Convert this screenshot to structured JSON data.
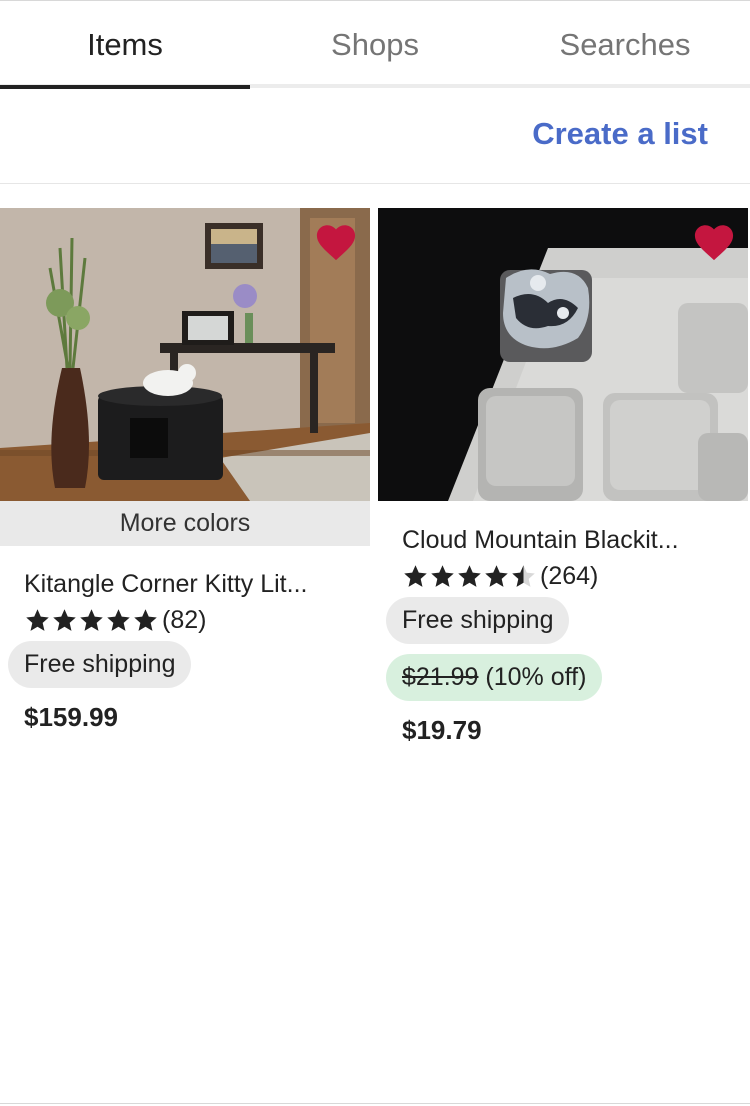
{
  "tabs": [
    {
      "label": "Items",
      "active": true
    },
    {
      "label": "Shops",
      "active": false
    },
    {
      "label": "Searches",
      "active": false
    }
  ],
  "list_bar": {
    "create_list_label": "Create a list"
  },
  "colors": {
    "accent": "#4a6bc8",
    "favorite": "#c4163f",
    "sale_bg": "#d8f0de",
    "pill_bg": "#eaeaea"
  },
  "products": [
    {
      "badge": "More colors",
      "title": "Kitangle Corner Kitty Lit...",
      "rating": 5,
      "review_count": "(82)",
      "shipping": "Free shipping",
      "price": "$159.99",
      "favorited": true,
      "image": "cat-litter-box-photo"
    },
    {
      "title": "Cloud Mountain Blackit...",
      "rating": 4.5,
      "review_count": "(264)",
      "shipping": "Free shipping",
      "original_price": "$21.99",
      "discount": "(10% off)",
      "price": "$19.79",
      "favorited": true,
      "image": "keyboard-keycap-photo"
    }
  ]
}
